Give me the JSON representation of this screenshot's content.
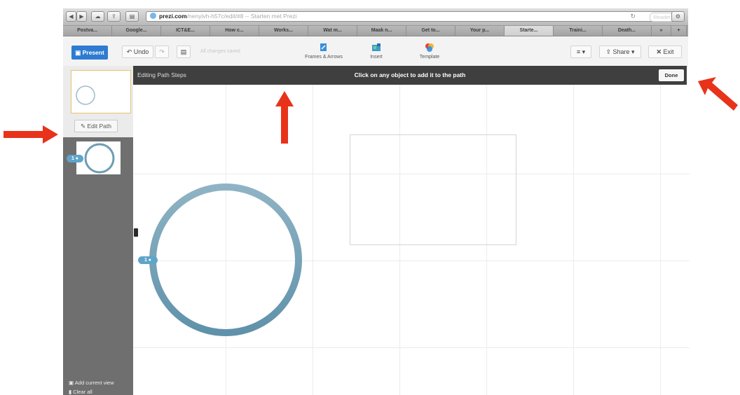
{
  "browser": {
    "url_domain": "prezi.com",
    "url_rest": "/nenyivh-h57c/edit/#8 -- Starten met Prezi",
    "reader_label": "Reader",
    "tabs": [
      "Postva...",
      "Google...",
      "ICT&E...",
      "How c...",
      "Works...",
      "Wat m...",
      "Maak n...",
      "Get to...",
      "Your p...",
      "Starte...",
      "Traini...",
      "Death...",
      "»",
      "+"
    ]
  },
  "toolbar": {
    "present_label": "Present",
    "undo_label": "Undo",
    "saved_label": "All changes saved",
    "frames_label": "Frames & Arrows",
    "insert_label": "Insert",
    "template_label": "Template",
    "share_label": "Share",
    "exit_label": "Exit"
  },
  "sidebar": {
    "edit_path_label": "Edit Path",
    "step_number": "1",
    "add_current_view_label": "Add current view",
    "clear_all_label": "Clear all"
  },
  "banner": {
    "left_label": "Editing Path Steps",
    "instruction": "Click on any object to add it to the path",
    "done_label": "Done"
  },
  "canvas": {
    "path_step_number": "1"
  },
  "colors": {
    "annotation_arrow": "#e8331a",
    "present_button": "#2e7bd1",
    "circle_stroke": "#6d9db3",
    "step_badge": "#5fa4c9"
  }
}
